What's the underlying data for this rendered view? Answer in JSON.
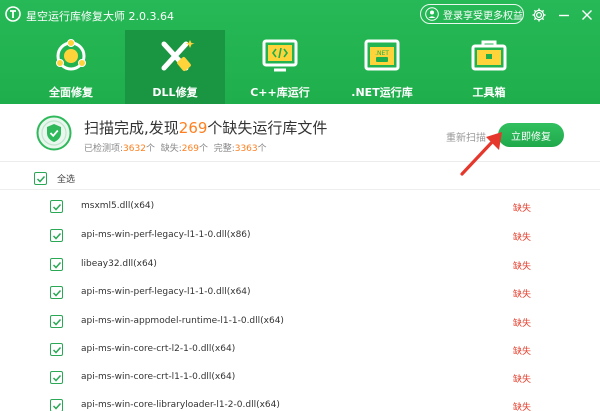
{
  "app": {
    "title": "星空运行库修复大师 2.0.3.64",
    "login_label": "登录享受更多权益"
  },
  "tabs": [
    {
      "label": "全面修复"
    },
    {
      "label": "DLL修复"
    },
    {
      "label": "C++库运行"
    },
    {
      "label": ".NET运行库"
    },
    {
      "label": "工具箱"
    }
  ],
  "summary": {
    "headline_prefix": "扫描完成,发现",
    "missing_count": "269",
    "headline_suffix": "个缺失运行库文件",
    "checked_label": "已检测项:",
    "checked_count": "3632",
    "unit": "个",
    "missing_label": "缺失:",
    "missing_count_small": "269",
    "complete_label": "完整:",
    "complete_count": "3363",
    "rescan_label": "重新扫描",
    "fix_label": "立即修复"
  },
  "select_all_label": "全选",
  "items": [
    {
      "name": "msxml5.dll(x64)",
      "status": "缺失"
    },
    {
      "name": "api-ms-win-perf-legacy-l1-1-0.dll(x86)",
      "status": "缺失"
    },
    {
      "name": "libeay32.dll(x64)",
      "status": "缺失"
    },
    {
      "name": "api-ms-win-perf-legacy-l1-1-0.dll(x64)",
      "status": "缺失"
    },
    {
      "name": "api-ms-win-appmodel-runtime-l1-1-0.dll(x64)",
      "status": "缺失"
    },
    {
      "name": "api-ms-win-core-crt-l2-1-0.dll(x64)",
      "status": "缺失"
    },
    {
      "name": "api-ms-win-core-crt-l1-1-0.dll(x64)",
      "status": "缺失"
    },
    {
      "name": "api-ms-win-core-libraryloader-l1-2-0.dll(x64)",
      "status": "缺失"
    }
  ],
  "colors": {
    "brand_green": "#27b957",
    "active_tab": "#1a9542",
    "accent_orange": "#ff7f1f",
    "missing_red": "#e5412f"
  }
}
